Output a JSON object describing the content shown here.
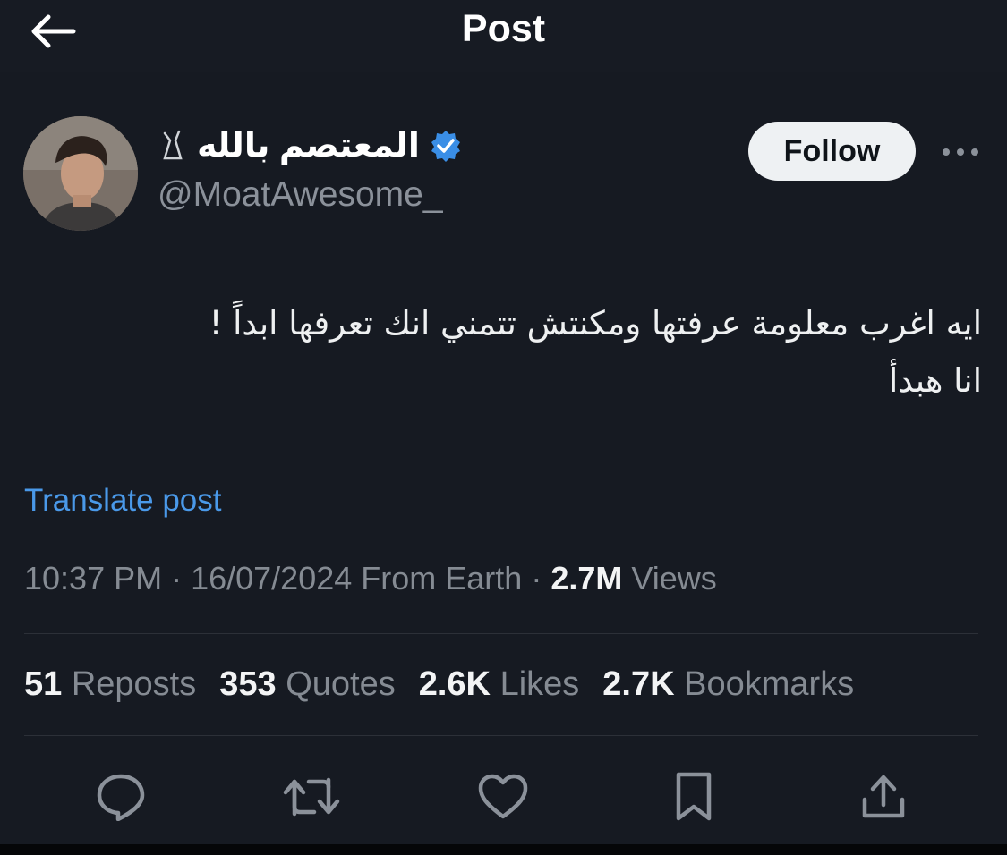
{
  "header": {
    "title": "Post",
    "back_icon": "arrow-left-icon"
  },
  "author": {
    "display_name": "المعتصم بالله",
    "verified_icon": "verified-badge-icon",
    "verified_color": "#1d9bf0",
    "handle": "@MoatAwesome_"
  },
  "follow_button": {
    "label": "Follow"
  },
  "more_icon": "more-horizontal-icon",
  "post": {
    "lines": [
      "ايه اغرب معلومة عرفتها ومكنتش تتمني انك تعرفها ابداً !",
      "انا هبدأ"
    ]
  },
  "translate_label": "Translate post",
  "meta": {
    "time": "10:37 PM",
    "sep1": " · ",
    "date": "16/07/2024",
    "location": " From Earth",
    "sep2": " · ",
    "views_count": "2.7M",
    "views_label": " Views"
  },
  "stats": [
    {
      "count": "51",
      "label": " Reposts"
    },
    {
      "count": "353",
      "label": " Quotes"
    },
    {
      "count": "2.6K",
      "label": " Likes"
    },
    {
      "count": "2.7K",
      "label": " Bookmarks"
    }
  ],
  "actions": [
    "reply-icon",
    "repost-icon",
    "like-icon",
    "bookmark-icon",
    "share-icon"
  ],
  "colors": {
    "background": "#161a22",
    "link": "#4a99e9",
    "muted": "#858b93"
  }
}
